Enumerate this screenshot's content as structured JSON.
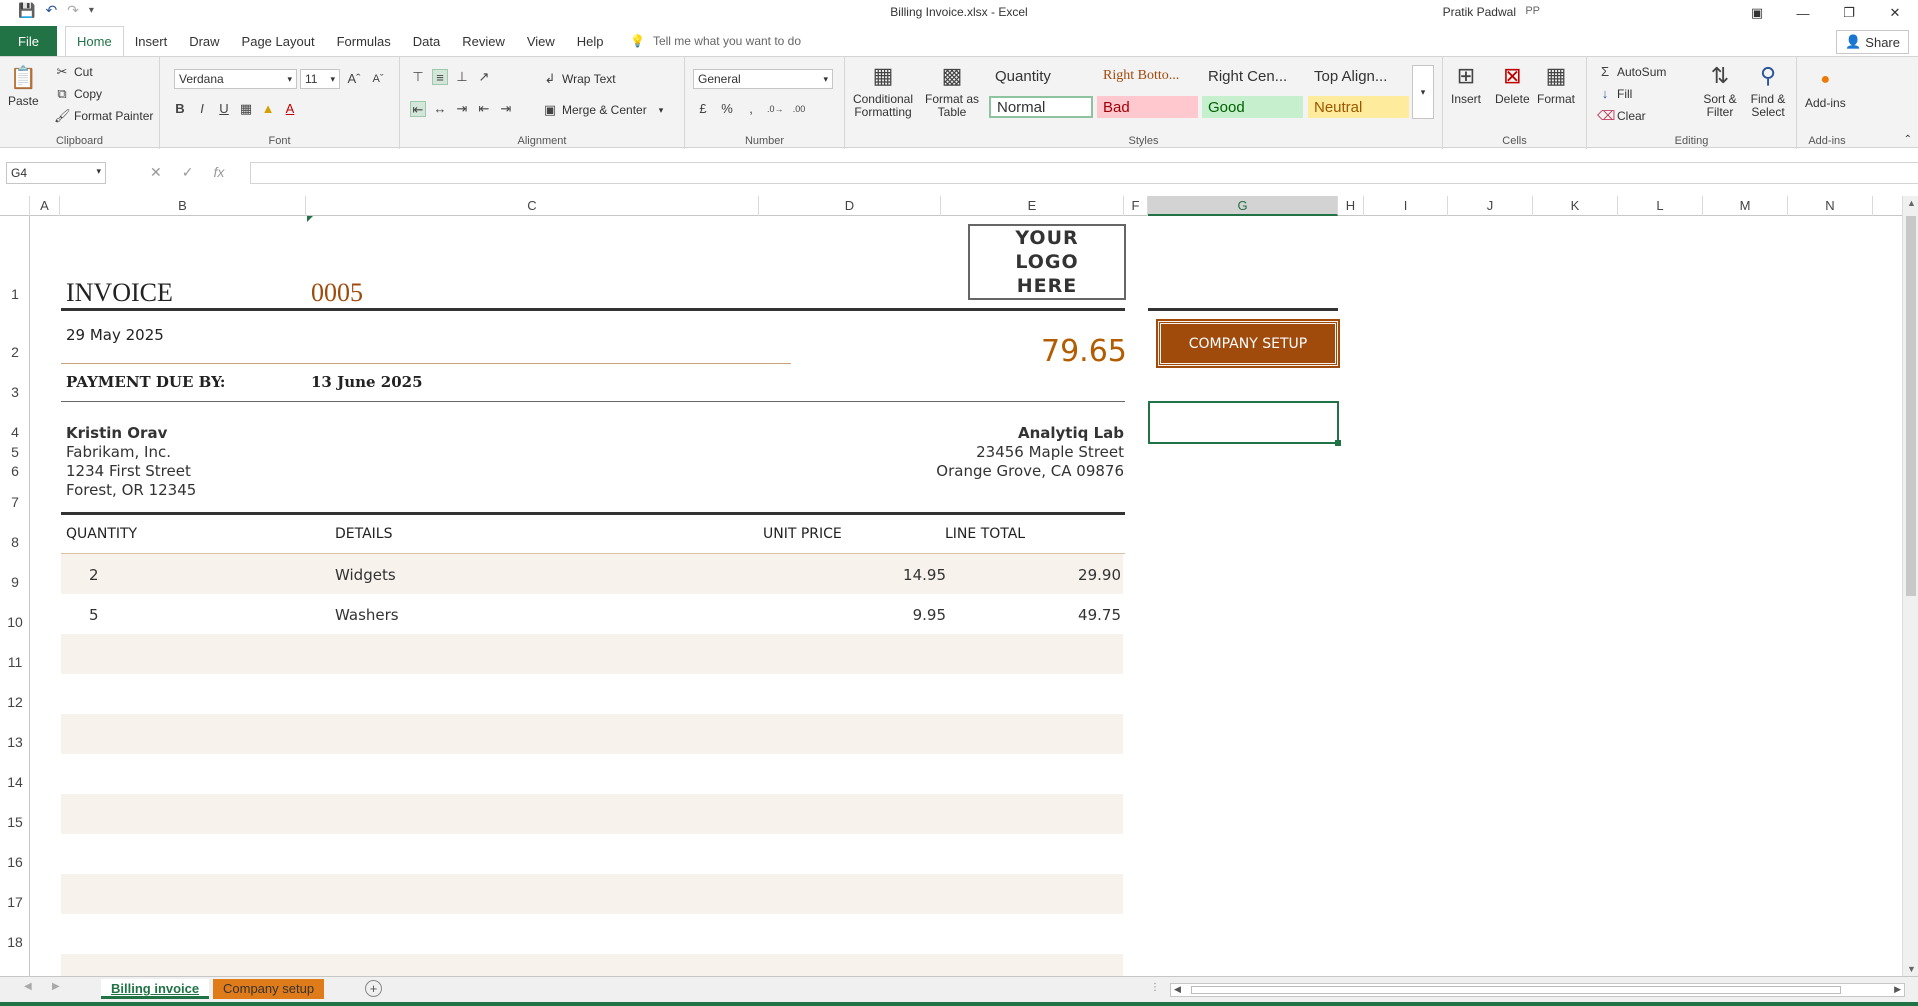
{
  "window": {
    "title": "Billing Invoice.xlsx  -  Excel",
    "user": "Pratik Padwal",
    "initials": "PP"
  },
  "ribbon_tabs": {
    "file": "File",
    "tabs": [
      "Home",
      "Insert",
      "Draw",
      "Page Layout",
      "Formulas",
      "Data",
      "Review",
      "View",
      "Help"
    ],
    "tell_me": "Tell me what you want to do",
    "share": "Share"
  },
  "clipboard": {
    "paste": "Paste",
    "cut": "Cut",
    "copy": "Copy",
    "format_painter": "Format Painter",
    "label": "Clipboard"
  },
  "font": {
    "name": "Verdana",
    "size": "11",
    "label": "Font"
  },
  "alignment": {
    "wrap": "Wrap Text",
    "merge": "Merge & Center",
    "label": "Alignment"
  },
  "number": {
    "format": "General",
    "label": "Number"
  },
  "styles": {
    "conditional": "Conditional Formatting",
    "format_table": "Format as Table",
    "cells": [
      "Quantity",
      "Right Botto...",
      "Right Cen...",
      "Top Align...",
      "Normal",
      "Bad",
      "Good",
      "Neutral"
    ],
    "label": "Styles"
  },
  "cells_group": {
    "insert": "Insert",
    "delete": "Delete",
    "format": "Format",
    "label": "Cells"
  },
  "editing": {
    "autosum": "AutoSum",
    "fill": "Fill",
    "clear": "Clear",
    "sort": "Sort & Filter",
    "find": "Find & Select",
    "label": "Editing"
  },
  "addins": {
    "addins": "Add-ins",
    "label": "Add-ins"
  },
  "formula_bar": {
    "name_box": "G4",
    "fx": "fx",
    "value": ""
  },
  "columns": [
    "A",
    "B",
    "C",
    "D",
    "E",
    "F",
    "G",
    "H",
    "I",
    "J",
    "K",
    "L",
    "M",
    "N"
  ],
  "rows": [
    "1",
    "2",
    "3",
    "4",
    "5",
    "6",
    "7",
    "8",
    "9",
    "10",
    "11",
    "12",
    "13",
    "14",
    "15",
    "16",
    "17",
    "18"
  ],
  "invoice": {
    "title": "INVOICE",
    "number": "0005",
    "logo": "YOUR LOGO HERE",
    "date": "29 May 2025",
    "total": "79.65",
    "due_label": "PAYMENT DUE BY:",
    "due_date": "13 June 2025",
    "bill_to": {
      "name": "Kristin Orav",
      "company": "Fabrikam, Inc.",
      "street": "1234 First Street",
      "city": "Forest,  OR 12345"
    },
    "from": {
      "name": "Analytiq Lab",
      "street": "23456 Maple Street",
      "city": "Orange Grove, CA 09876"
    },
    "headers": {
      "quantity": "QUANTITY",
      "details": "DETAILS",
      "unit_price": "UNIT PRICE",
      "line_total": "LINE TOTAL"
    },
    "items": [
      {
        "qty": "2",
        "details": "Widgets",
        "unit_price": "14.95",
        "line_total": "29.90"
      },
      {
        "qty": "5",
        "details": "Washers",
        "unit_price": "9.95",
        "line_total": "49.75"
      }
    ],
    "company_setup_button": "COMPANY SETUP"
  },
  "sheet_tabs": [
    "Billing invoice",
    "Company setup"
  ],
  "colors": {
    "excel_green": "#217346",
    "accent_brown": "#a04a0c",
    "number_color": "#b35c00",
    "band": "#f7f2ec"
  }
}
